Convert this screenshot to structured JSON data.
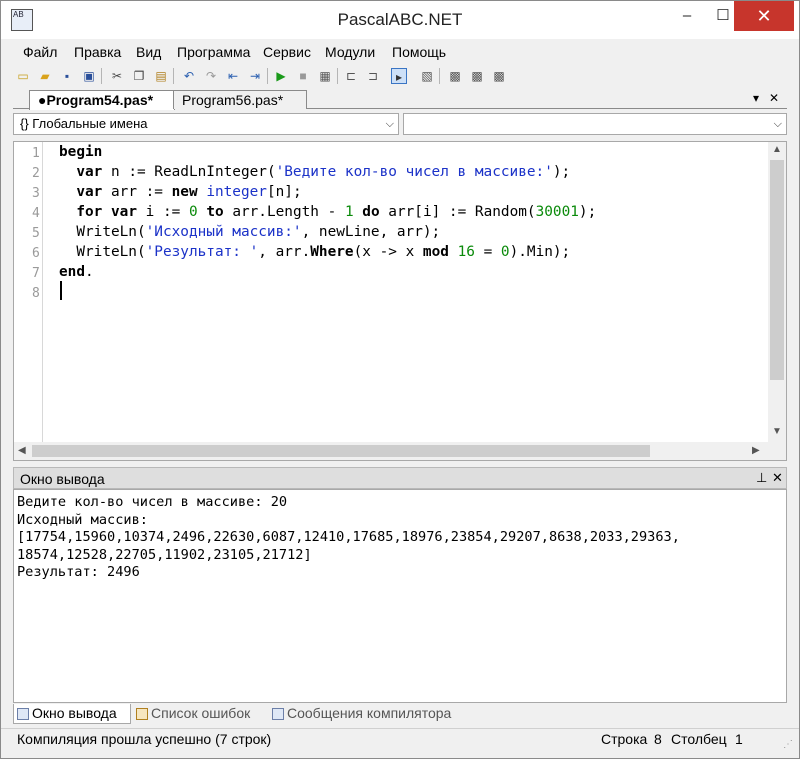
{
  "window": {
    "title": "PascalABC.NET",
    "app_icon_text": "AB",
    "controls": {
      "minimize": "–",
      "maximize": "☐",
      "close": "✕"
    }
  },
  "menu": [
    "Файл",
    "Правка",
    "Вид",
    "Программа",
    "Сервис",
    "Модули",
    "Помощь"
  ],
  "toolbar": {
    "icons": [
      "new-file-icon",
      "open-file-icon",
      "save-icon",
      "save-all-icon",
      "cut-icon",
      "copy-icon",
      "paste-icon",
      "undo-icon",
      "redo-icon",
      "back-icon",
      "forward-icon",
      "run-icon",
      "stop-icon",
      "compile-icon",
      "step-icon",
      "step-over-icon",
      "console-icon",
      "format-icon",
      "debug1-icon",
      "debug2-icon",
      "debug3-icon"
    ]
  },
  "tabs": {
    "active": "●Program54.pas*",
    "inactive": "Program56.pas*",
    "dropdown_glyph": "▾",
    "close_glyph": "✕"
  },
  "combos": {
    "left_value": "{} Глобальные имена",
    "right_value": ""
  },
  "editor": {
    "line_numbers": [
      "1",
      "2",
      "3",
      "4",
      "5",
      "6",
      "7",
      "8"
    ],
    "current_line": 8
  },
  "output": {
    "title": "Окно вывода",
    "pin_glyph": "⊥",
    "close_glyph": "✕",
    "lines": [
      "Ведите кол-во чисел в массиве: 20",
      "Исходный массив:",
      "[17754,15960,10374,2496,22630,6087,12410,17685,18976,23854,29207,8638,2033,29363,",
      "18574,12528,22705,11902,23105,21712]",
      "Результат: 2496"
    ]
  },
  "bottom_tabs": [
    "Окно вывода",
    "Список ошибок",
    "Сообщения компилятора"
  ],
  "status": {
    "message": "Компиляция прошла успешно (7 строк)",
    "row_label": "Строка",
    "row_value": "8",
    "col_label": "Столбец",
    "col_value": "1"
  },
  "colors": {
    "keyword": "#000000",
    "string": "#1b32c8",
    "number": "#0a8a0a",
    "close_button": "#c7352c"
  }
}
